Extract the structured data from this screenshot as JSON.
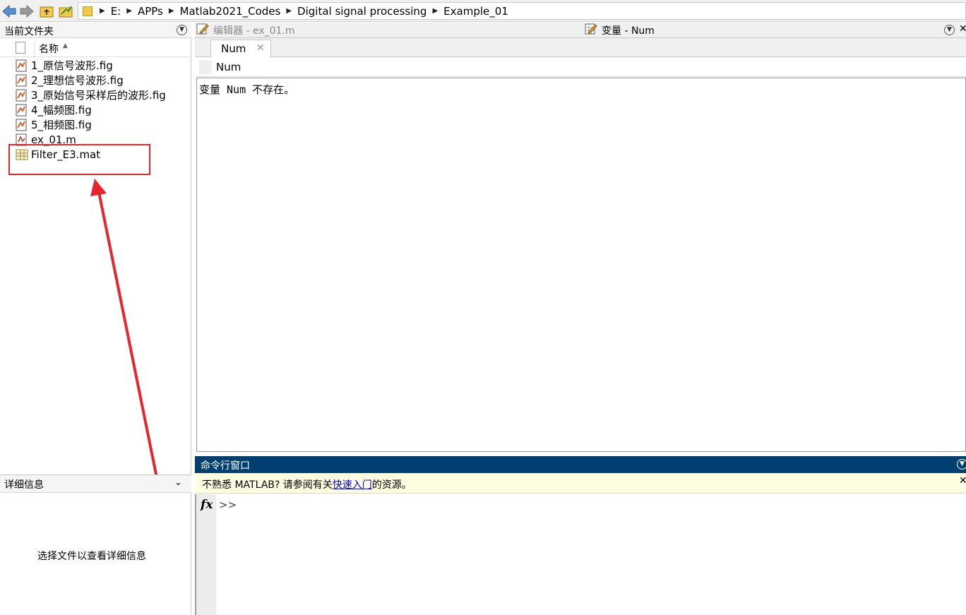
{
  "address": {
    "crumbs": [
      "E:",
      "APPs",
      "Matlab2021_Codes",
      "Digital signal processing",
      "Example_01"
    ]
  },
  "current_folder": {
    "title": "当前文件夹",
    "column_name": "名称",
    "files": [
      {
        "name": "1_原信号波形.fig",
        "icon": "fig-file-icon"
      },
      {
        "name": "2_理想信号波形.fig",
        "icon": "fig-file-icon"
      },
      {
        "name": "3_原始信号采样后的波形.fig",
        "icon": "fig-file-icon"
      },
      {
        "name": "4_幅频图.fig",
        "icon": "fig-file-icon"
      },
      {
        "name": "5_相频图.fig",
        "icon": "fig-file-icon"
      },
      {
        "name": "ex_01.m",
        "icon": "m-file-icon"
      },
      {
        "name": "Filter_E3.mat",
        "icon": "mat-file-icon"
      }
    ]
  },
  "details": {
    "title": "详细信息",
    "annotation": "选择文件以查看详细信息"
  },
  "editor_tab": {
    "label": "编辑器 - ex_01.m"
  },
  "variable_tab": {
    "label": "变量 - Num"
  },
  "variable_editor": {
    "tab_label": "Num",
    "header_label": "Num",
    "message": "变量 Num 不存在。"
  },
  "command_window": {
    "title": "命令行窗口",
    "notice_prefix": "不熟悉 MATLAB? 请参阅有关",
    "notice_link": "快速入门",
    "notice_suffix": "的资源。",
    "prompt": ">>",
    "fx": "fx"
  },
  "colors": {
    "command_title_bg": "#003f70",
    "notice_bg": "#fdfde0",
    "annotation_red": "#e5262e",
    "link": "#0000ee"
  }
}
